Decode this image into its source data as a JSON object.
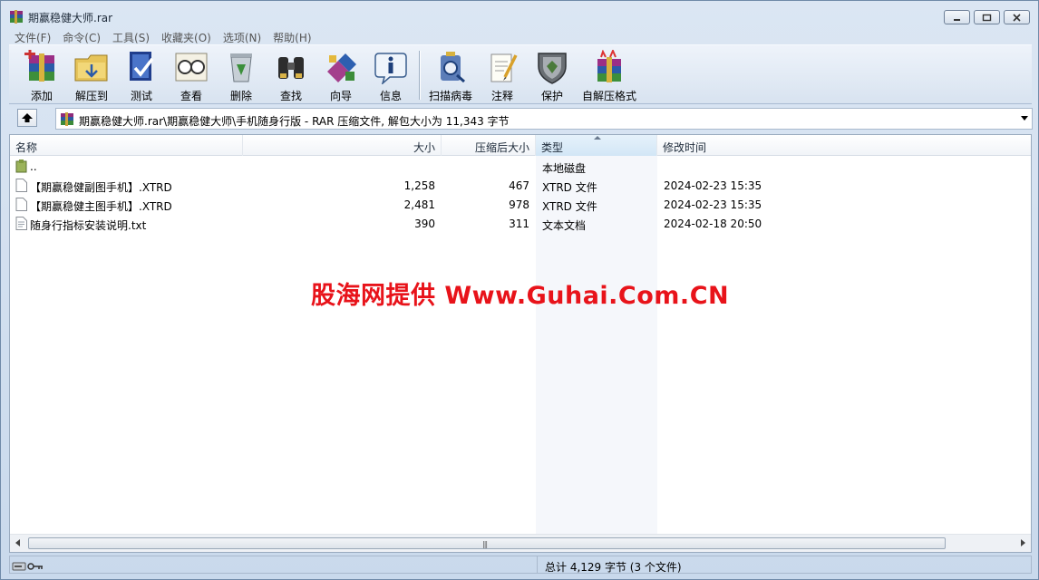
{
  "window": {
    "title": "期赢稳健大师.rar"
  },
  "menu": [
    "文件(F)",
    "命令(C)",
    "工具(S)",
    "收藏夹(O)",
    "选项(N)",
    "帮助(H)"
  ],
  "toolbar": {
    "add": "添加",
    "extract": "解压到",
    "test": "测试",
    "view": "查看",
    "delete": "删除",
    "find": "查找",
    "wizard": "向导",
    "info": "信息",
    "virus_scan": "扫描病毒",
    "comment": "注释",
    "protect": "保护",
    "sfx": "自解压格式"
  },
  "address": {
    "path": "期赢稳健大师.rar\\期赢稳健大师\\手机随身行版 - RAR 压缩文件, 解包大小为 11,343 字节"
  },
  "columns": {
    "name": "名称",
    "size": "大小",
    "packed": "压缩后大小",
    "type": "类型",
    "modified": "修改时间"
  },
  "files": [
    {
      "name": "..",
      "size": "",
      "packed": "",
      "type": "本地磁盘",
      "modified": ""
    },
    {
      "name": "【期赢稳健副图手机】.XTRD",
      "size": "1,258",
      "packed": "467",
      "type": "XTRD 文件",
      "modified": "2024-02-23 15:35"
    },
    {
      "name": "【期赢稳健主图手机】.XTRD",
      "size": "2,481",
      "packed": "978",
      "type": "XTRD 文件",
      "modified": "2024-02-23 15:35"
    },
    {
      "name": "随身行指标安装说明.txt",
      "size": "390",
      "packed": "311",
      "type": "文本文档",
      "modified": "2024-02-18 20:50"
    }
  ],
  "watermark": "股海网提供 Www.Guhai.Com.CN",
  "status": {
    "total": "总计 4,129 字节 (3 个文件)"
  }
}
